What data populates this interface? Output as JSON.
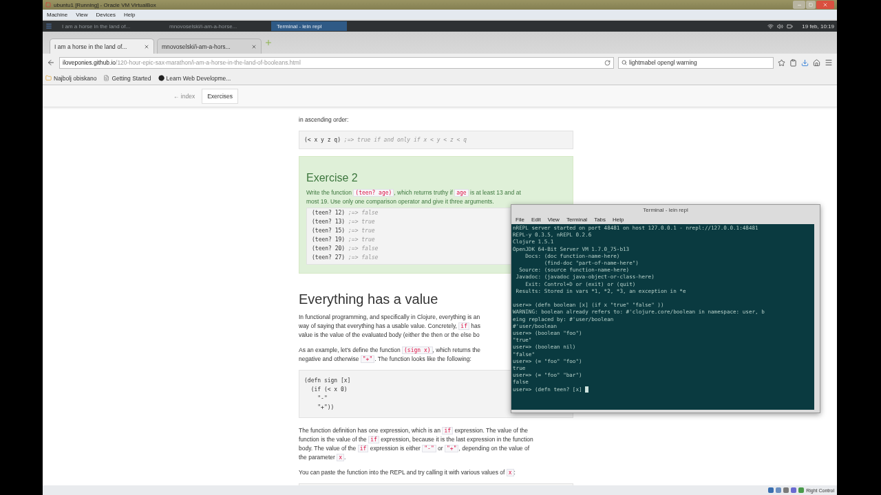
{
  "vm_window": {
    "title": "ubuntu1 [Running] - Oracle VM VirtualBox",
    "menu": [
      "Machine",
      "View",
      "Devices",
      "Help"
    ],
    "status_text": "Right Control"
  },
  "guest_panel": {
    "tasks": [
      {
        "label": "I am a horse in the land of...",
        "selected": false
      },
      {
        "label": "mnovoselski/i-am-a-horse...",
        "selected": false
      },
      {
        "label": "Terminal - lein repl",
        "selected": true
      }
    ],
    "clock": "19 feb, 10:19"
  },
  "browser": {
    "tabs": [
      {
        "title": "I am a horse in the land of...",
        "selected": true
      },
      {
        "title": "mnovoselski/i-am-a-hors...",
        "selected": false
      }
    ],
    "url_host": "iloveponies.github.io",
    "url_path": "/120-hour-epic-sax-marathon/i-am-a-horse-in-the-land-of-booleans.html",
    "search": "lightmabel opengl warning",
    "bookmarks": [
      "Najbolj obiskano",
      "Getting Started",
      "Learn Web Developme..."
    ]
  },
  "page": {
    "nav": {
      "back_link": "← index",
      "button": "Exercises"
    },
    "intro": "in ascending order:",
    "intro_code": [
      {
        "code": "(< x y z q)",
        "comment": ";=> true if and only if x < y < z < q"
      }
    ],
    "exercise": {
      "title": "Exercise 2",
      "text": [
        [
          {
            "kind": "text",
            "t": "Write the function "
          },
          {
            "kind": "code",
            "t": "(teen? age)"
          },
          {
            "kind": "text",
            "t": ", which returns truthy if "
          },
          {
            "kind": "code",
            "t": "age"
          },
          {
            "kind": "text",
            "t": " is at least 13 and at"
          }
        ],
        [
          {
            "kind": "text",
            "t": "most 19. Use only one comparison operator and give it three arguments."
          }
        ]
      ],
      "code": [
        {
          "code": "(teen? 12)",
          "comment": ";=> false"
        },
        {
          "code": "(teen? 13)",
          "comment": ";=> true"
        },
        {
          "code": "(teen? 15)",
          "comment": ";=> true"
        },
        {
          "code": "(teen? 19)",
          "comment": ";=> true"
        },
        {
          "code": "(teen? 20)",
          "comment": ";=> false"
        },
        {
          "code": "(teen? 27)",
          "comment": ";=> false"
        }
      ]
    },
    "heading": "Everything has a value",
    "paragraphs": [
      [
        [
          {
            "kind": "text",
            "t": "In functional programming, and specifically in Clojure, everything is an"
          }
        ],
        [
          {
            "kind": "text",
            "t": "way of saying that everything has a usable value. Concretely, "
          },
          {
            "kind": "code",
            "t": "if"
          },
          {
            "kind": "text",
            "t": " has"
          }
        ],
        [
          {
            "kind": "text",
            "t": "value is the value of the evaluated body (either the then or the else bo"
          }
        ]
      ],
      [
        [
          {
            "kind": "text",
            "t": "As an example, let's define the function "
          },
          {
            "kind": "code",
            "t": "(sign x)"
          },
          {
            "kind": "text",
            "t": ", which returns the"
          }
        ],
        [
          {
            "kind": "text",
            "t": "negative and otherwise "
          },
          {
            "kind": "code",
            "t": "\"+\""
          },
          {
            "kind": "text",
            "t": ". The function looks like the following:"
          }
        ]
      ]
    ],
    "sign_code": [
      {
        "code": "(defn sign [x]"
      },
      {
        "code": "  (if (< x 0)"
      },
      {
        "code": "    \"-\""
      },
      {
        "code": "    \"+\"))"
      }
    ],
    "paragraphs_after": [
      [
        [
          {
            "kind": "text",
            "t": "The function definition has one expression, which is an "
          },
          {
            "kind": "code",
            "t": "if"
          },
          {
            "kind": "text",
            "t": " expression. The value of the"
          }
        ],
        [
          {
            "kind": "text",
            "t": "function is the value of the "
          },
          {
            "kind": "code",
            "t": "if"
          },
          {
            "kind": "text",
            "t": " expression, because it is the last expression in the function"
          }
        ],
        [
          {
            "kind": "text",
            "t": "body. The value of the "
          },
          {
            "kind": "code",
            "t": "if"
          },
          {
            "kind": "text",
            "t": " expression is either "
          },
          {
            "kind": "code",
            "t": "\"-\""
          },
          {
            "kind": "text",
            "t": " or "
          },
          {
            "kind": "code",
            "t": "\"+\""
          },
          {
            "kind": "text",
            "t": ", depending on the value of"
          }
        ],
        [
          {
            "kind": "text",
            "t": "the parameter "
          },
          {
            "kind": "code",
            "t": "x"
          },
          {
            "kind": "text",
            "t": "."
          }
        ]
      ],
      [
        [
          {
            "kind": "text",
            "t": "You can paste the function into the REPL and try calling it with various values of "
          },
          {
            "kind": "code",
            "t": "x"
          },
          {
            "kind": "text",
            "t": ":"
          }
        ]
      ]
    ]
  },
  "terminal": {
    "title": "Terminal - lein repl",
    "menu": [
      "File",
      "Edit",
      "View",
      "Terminal",
      "Tabs",
      "Help"
    ],
    "banner": [
      "nREPL server started on port 48481 on host 127.0.0.1 - nrepl://127.0.0.1:48481",
      "REPL-y 0.3.5, nREPL 0.2.6",
      "Clojure 1.5.1",
      "OpenJDK 64-Bit Server VM 1.7.0_75-b13",
      "    Docs: (doc function-name-here)",
      "          (find-doc \"part-of-name-here\")",
      "  Source: (source function-name-here)",
      " Javadoc: (javadoc java-object-or-class-here)",
      "    Exit: Control+D or (exit) or (quit)",
      " Results: Stored in vars *1, *2, *3, an exception in *e"
    ],
    "session": [
      "user=> (defn boolean [x] (if x \"true\" \"false\" ))",
      "WARNING: boolean already refers to: #'clojure.core/boolean in namespace: user, b",
      "eing replaced by: #'user/boolean",
      "#'user/boolean",
      "user=> (boolean \"foo\")",
      "\"true\"",
      "user=> (boolean nil)",
      "\"false\"",
      "user=> (= \"foo\" \"foo\")",
      "true",
      "user=> (= \"foo\" \"bar\")",
      "false"
    ],
    "prompt": "user=> (defn teen? [x] ",
    "cursor": true
  }
}
